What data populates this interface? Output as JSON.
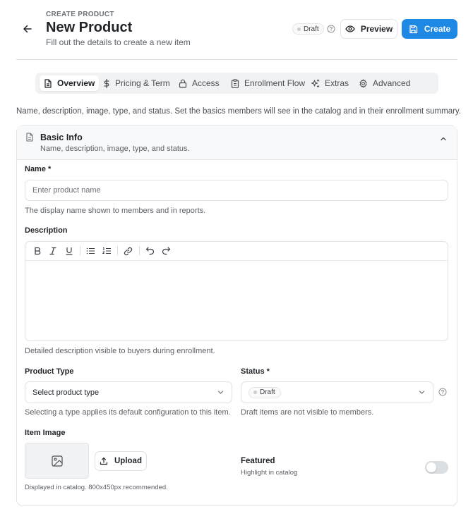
{
  "header": {
    "eyebrow": "CREATE PRODUCT",
    "title": "New Product",
    "subtitle": "Fill out the details to create a new item",
    "status_badge": "Draft",
    "preview_label": "Preview",
    "create_label": "Create",
    "accent_color": "#1e88e5"
  },
  "tabs": [
    {
      "label": "Overview",
      "icon": "document-icon",
      "active": true
    },
    {
      "label": "Pricing & Term",
      "icon": "dollar-icon",
      "active": false
    },
    {
      "label": "Access",
      "icon": "lock-icon",
      "active": false
    },
    {
      "label": "Enrollment Flow",
      "icon": "clipboard-icon",
      "active": false
    },
    {
      "label": "Extras",
      "icon": "sparkles-icon",
      "active": false
    },
    {
      "label": "Advanced",
      "icon": "gear-icon",
      "active": false
    }
  ],
  "intro": "Name, description, image, type, and status. Set the basics members will see in the catalog and in their enrollment summary.",
  "section": {
    "title": "Basic Info",
    "subtitle": "Name, description, image, type, and status."
  },
  "fields": {
    "name": {
      "label": "Name *",
      "placeholder": "Enter product name",
      "value": "",
      "helper": "The display name shown to members and in reports."
    },
    "description": {
      "label": "Description",
      "helper": "Detailed description visible to buyers during enrollment.",
      "toolbar": [
        "bold-icon",
        "italic-icon",
        "underline-icon",
        "bullet-list-icon",
        "numbered-list-icon",
        "link-icon",
        "undo-icon",
        "redo-icon"
      ]
    },
    "product_type": {
      "label": "Product Type",
      "placeholder": "Select product type",
      "helper": "Selecting a type applies its default configuration to this item."
    },
    "status": {
      "label": "Status *",
      "value": "Draft",
      "helper": "Draft items are not visible to members."
    },
    "item_image": {
      "label": "Item Image",
      "upload_label": "Upload",
      "helper": "Displayed in catalog. 800x450px recommended."
    },
    "featured": {
      "label": "Featured",
      "helper": "Highlight in catalog",
      "enabled": false
    }
  }
}
